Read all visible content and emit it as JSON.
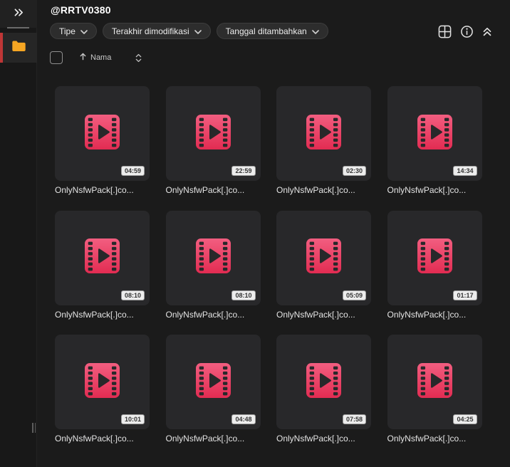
{
  "sidebar": {
    "collapse_icon": "chevrons-right-icon",
    "folder_item": {
      "icon": "folder-icon",
      "selected": true
    }
  },
  "header": {
    "title": "@RRTV0380",
    "filters": [
      {
        "label": "Tipe"
      },
      {
        "label": "Terakhir dimodifikasi"
      },
      {
        "label": "Tanggal ditambahkan"
      }
    ],
    "actions": [
      "grid-view-icon",
      "info-icon",
      "collapse-all-icon"
    ],
    "sort": {
      "label": "Nama",
      "direction": "ascending"
    }
  },
  "files": [
    {
      "name": "OnlyNsfwPack[.]co...",
      "duration": "04:59",
      "type": "video"
    },
    {
      "name": "OnlyNsfwPack[.]co...",
      "duration": "22:59",
      "type": "video"
    },
    {
      "name": "OnlyNsfwPack[.]co...",
      "duration": "02:30",
      "type": "video"
    },
    {
      "name": "OnlyNsfwPack[.]co...",
      "duration": "14:34",
      "type": "video"
    },
    {
      "name": "OnlyNsfwPack[.]co...",
      "duration": "08:10",
      "type": "video"
    },
    {
      "name": "OnlyNsfwPack[.]co...",
      "duration": "08:10",
      "type": "video"
    },
    {
      "name": "OnlyNsfwPack[.]co...",
      "duration": "05:09",
      "type": "video"
    },
    {
      "name": "OnlyNsfwPack[.]co...",
      "duration": "01:17",
      "type": "video"
    },
    {
      "name": "OnlyNsfwPack[.]co...",
      "duration": "10:01",
      "type": "video"
    },
    {
      "name": "OnlyNsfwPack[.]co...",
      "duration": "04:48",
      "type": "video"
    },
    {
      "name": "OnlyNsfwPack[.]co...",
      "duration": "07:58",
      "type": "video"
    },
    {
      "name": "OnlyNsfwPack[.]co...",
      "duration": "04:25",
      "type": "video"
    }
  ],
  "colors": {
    "video_icon_pink_top": "#f25e80",
    "video_icon_pink_bottom": "#e22c52",
    "folder_orange": "#f6a623",
    "selection_red": "#bf3636",
    "badge_bg": "#ededed",
    "card_bg": "#28282a",
    "main_bg": "#1b1b1b"
  }
}
